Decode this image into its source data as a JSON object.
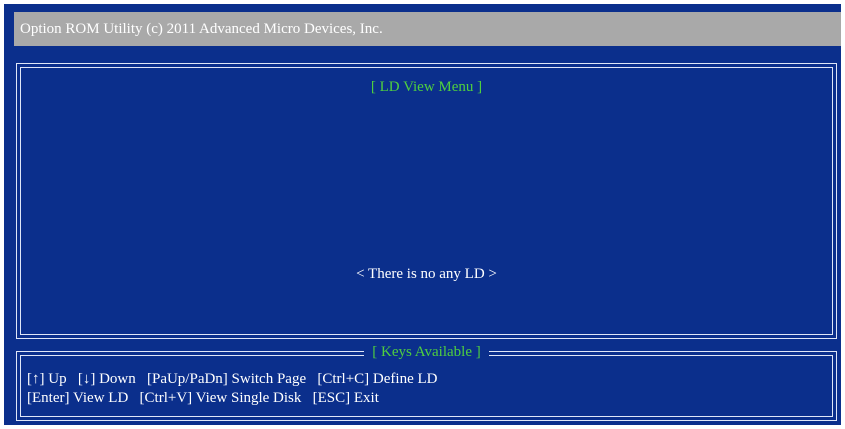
{
  "app": {
    "title": "Option ROM Utility (c) 2011 Advanced Micro Devices, Inc."
  },
  "main_panel": {
    "title": "[ LD  View Menu ]",
    "empty_message": "< There is no any LD >"
  },
  "keys_panel": {
    "title": "[ Keys Available ]",
    "lines": [
      "[↑] Up   [↓] Down   [PaUp/PaDn] Switch Page   [Ctrl+C] Define LD",
      "[Enter] View LD   [Ctrl+V] View Single Disk   [ESC] Exit"
    ]
  },
  "colors": {
    "background": "#0b2f8c",
    "title_bar": "#a9a9a9",
    "accent_green": "#4fcf3f",
    "text": "#ffffff"
  }
}
